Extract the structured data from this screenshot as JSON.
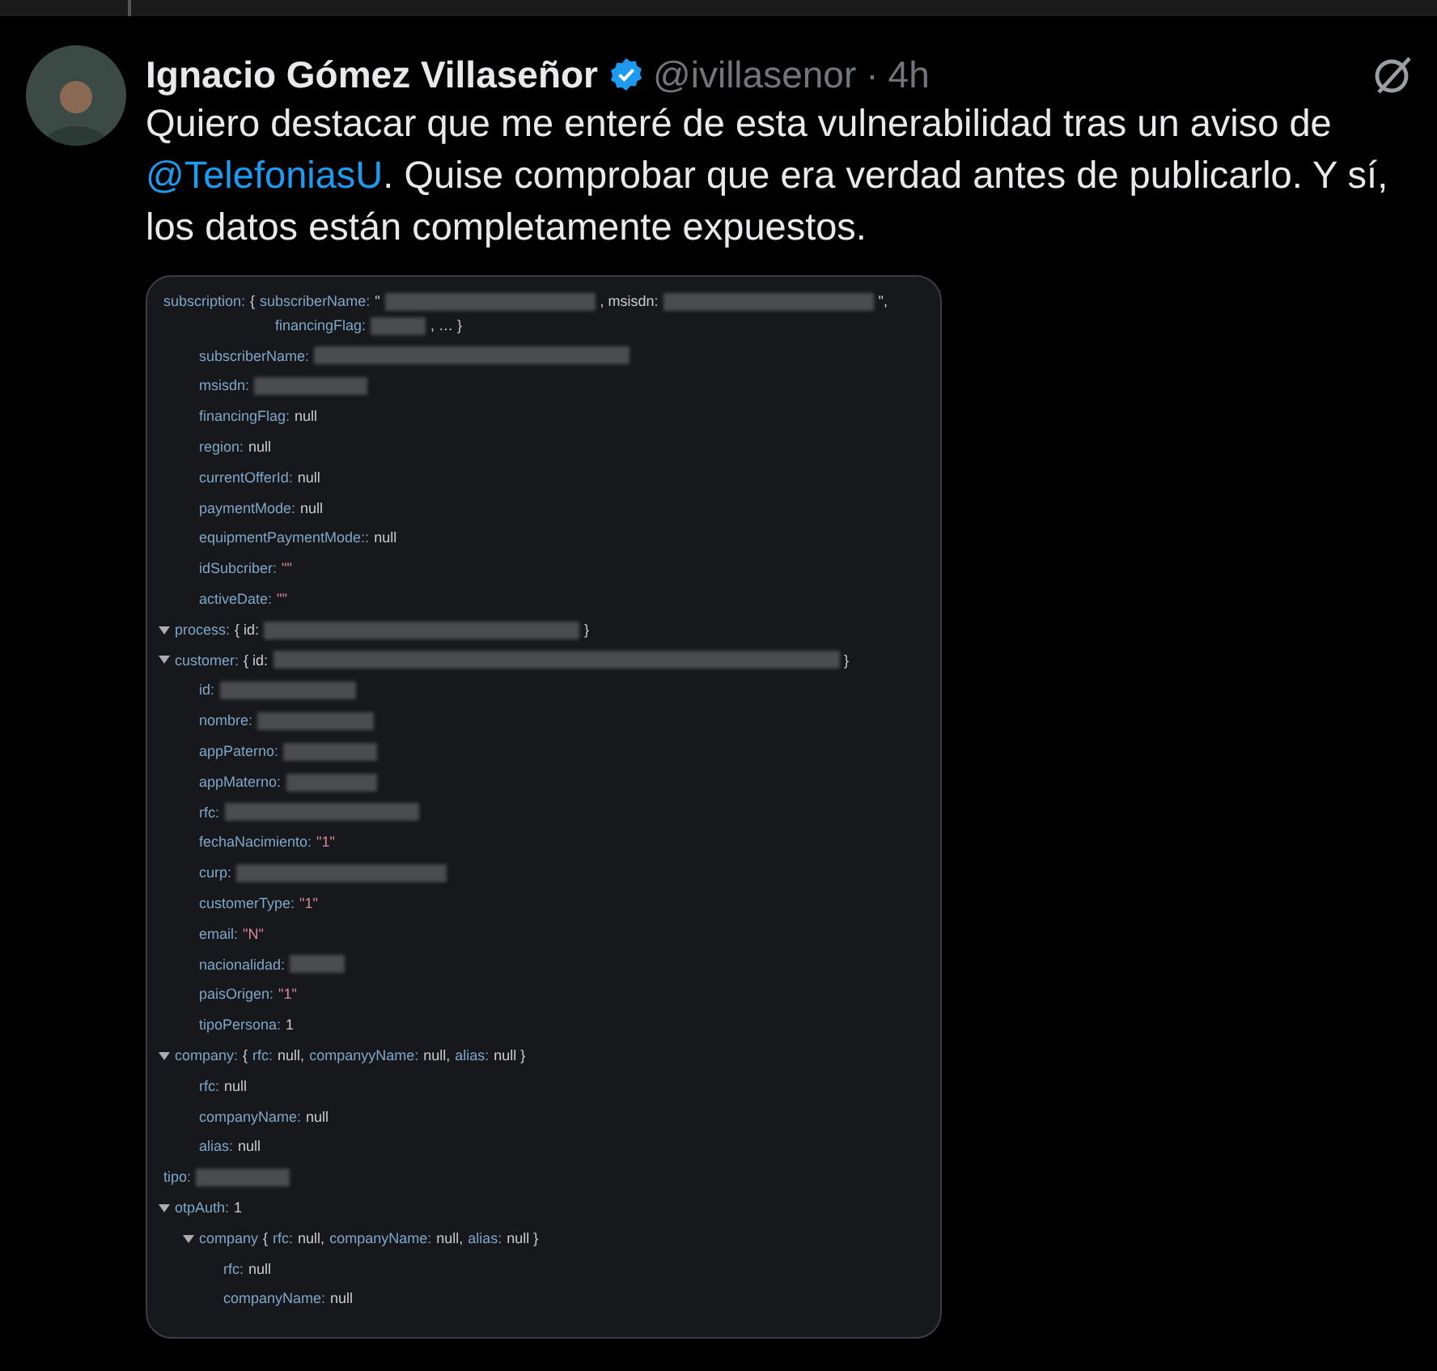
{
  "tweet": {
    "author": {
      "name": "Ignacio Gómez Villaseñor",
      "verified": true,
      "handle": "@ivillasenor",
      "separator": "·",
      "time": "4h"
    },
    "text": {
      "before": "Quiero destacar que me enteré de esta vulnerabilidad tras un aviso de",
      "mention": "@TelefoniasU",
      "after": ". Quise comprobar que era verdad antes de publicarlo. Y sí, los datos están completamente expuestos."
    },
    "media": {
      "rows": [
        {
          "toggle": false,
          "segments": [
            {
              "kind": "key",
              "text": "subscription:"
            },
            {
              "kind": "value",
              "text": "{"
            },
            {
              "kind": "key",
              "text": "subscriberName:"
            },
            {
              "kind": "value",
              "text": "\""
            },
            {
              "kind": "redacted"
            },
            {
              "kind": "value",
              "text": ", msisdn:"
            },
            {
              "kind": "redacted"
            },
            {
              "kind": "value",
              "text": "\","
            }
          ],
          "continuation": [
            {
              "kind": "key",
              "text": "financingFlag:"
            },
            {
              "kind": "redacted"
            },
            {
              "kind": "value",
              "text": ", … }"
            }
          ],
          "children": [
            {
              "toggle": false,
              "segments": [
                {
                  "kind": "key",
                  "text": "subscriberName:"
                },
                {
                  "kind": "redacted"
                }
              ]
            },
            {
              "toggle": false,
              "segments": [
                {
                  "kind": "key",
                  "text": "msisdn:"
                },
                {
                  "kind": "redacted"
                }
              ]
            },
            {
              "toggle": false,
              "segments": [
                {
                  "kind": "key",
                  "text": "financingFlag:"
                },
                {
                  "kind": "value",
                  "text": "null"
                }
              ]
            },
            {
              "toggle": false,
              "segments": [
                {
                  "kind": "key",
                  "text": "region:"
                },
                {
                  "kind": "value",
                  "text": "null"
                }
              ]
            },
            {
              "toggle": false,
              "segments": [
                {
                  "kind": "key",
                  "text": "currentOfferId:"
                },
                {
                  "kind": "value",
                  "text": "null"
                }
              ]
            },
            {
              "toggle": false,
              "segments": [
                {
                  "kind": "key",
                  "text": "paymentMode:"
                },
                {
                  "kind": "value",
                  "text": "null"
                }
              ]
            },
            {
              "toggle": false,
              "segments": [
                {
                  "kind": "key",
                  "text": "equipmentPaymentMode::"
                },
                {
                  "kind": "value",
                  "text": "null"
                }
              ]
            },
            {
              "toggle": false,
              "segments": [
                {
                  "kind": "key",
                  "text": "idSubcriber:"
                },
                {
                  "kind": "string",
                  "text": "\"\""
                }
              ]
            },
            {
              "toggle": false,
              "segments": [
                {
                  "kind": "key",
                  "text": "activeDate:"
                },
                {
                  "kind": "string",
                  "text": "\"\""
                }
              ]
            }
          ]
        },
        {
          "toggle": true,
          "segments": [
            {
              "kind": "key",
              "text": "process:"
            },
            {
              "kind": "value",
              "text": "{ id:"
            },
            {
              "kind": "redacted"
            },
            {
              "kind": "value",
              "text": "}"
            }
          ]
        },
        {
          "toggle": true,
          "segments": [
            {
              "kind": "key",
              "text": "customer:"
            },
            {
              "kind": "value",
              "text": "{ id:"
            },
            {
              "kind": "redacted"
            },
            {
              "kind": "value",
              "text": "}"
            }
          ],
          "children": [
            {
              "toggle": false,
              "segments": [
                {
                  "kind": "key",
                  "text": "id:"
                },
                {
                  "kind": "redacted"
                }
              ]
            },
            {
              "toggle": false,
              "segments": [
                {
                  "kind": "key",
                  "text": "nombre:"
                },
                {
                  "kind": "redacted"
                }
              ]
            },
            {
              "toggle": false,
              "segments": [
                {
                  "kind": "key",
                  "text": "appPaterno:"
                },
                {
                  "kind": "redacted"
                }
              ]
            },
            {
              "toggle": false,
              "segments": [
                {
                  "kind": "key",
                  "text": "appMaterno:"
                },
                {
                  "kind": "redacted"
                }
              ]
            },
            {
              "toggle": false,
              "segments": [
                {
                  "kind": "key",
                  "text": "rfc:"
                },
                {
                  "kind": "redacted"
                }
              ]
            },
            {
              "toggle": false,
              "segments": [
                {
                  "kind": "key",
                  "text": "fechaNacimiento:"
                },
                {
                  "kind": "string",
                  "text": "\"1\""
                }
              ]
            },
            {
              "toggle": false,
              "segments": [
                {
                  "kind": "key",
                  "text": "curp:"
                },
                {
                  "kind": "redacted"
                }
              ]
            },
            {
              "toggle": false,
              "segments": [
                {
                  "kind": "key",
                  "text": "customerType:"
                },
                {
                  "kind": "string",
                  "text": "\"1\""
                }
              ]
            },
            {
              "toggle": false,
              "segments": [
                {
                  "kind": "key",
                  "text": "email:"
                },
                {
                  "kind": "string",
                  "text": "\"N\""
                }
              ]
            },
            {
              "toggle": false,
              "segments": [
                {
                  "kind": "key",
                  "text": "nacionalidad:"
                },
                {
                  "kind": "redacted"
                }
              ]
            },
            {
              "toggle": false,
              "segments": [
                {
                  "kind": "key",
                  "text": "paisOrigen:"
                },
                {
                  "kind": "string",
                  "text": "\"1\""
                }
              ]
            },
            {
              "toggle": false,
              "segments": [
                {
                  "kind": "key",
                  "text": "tipoPersona:"
                },
                {
                  "kind": "value",
                  "text": "1"
                }
              ]
            }
          ]
        },
        {
          "toggle": true,
          "segments": [
            {
              "kind": "key",
              "text": "company:"
            },
            {
              "kind": "value",
              "text": "{"
            },
            {
              "kind": "key",
              "text": "rfc:"
            },
            {
              "kind": "value",
              "text": "null,"
            },
            {
              "kind": "key",
              "text": "companyyName:"
            },
            {
              "kind": "value",
              "text": "null,"
            },
            {
              "kind": "key",
              "text": "alias:"
            },
            {
              "kind": "value",
              "text": "null }"
            }
          ],
          "children": [
            {
              "toggle": false,
              "segments": [
                {
                  "kind": "key",
                  "text": "rfc:"
                },
                {
                  "kind": "value",
                  "text": "null"
                }
              ]
            },
            {
              "toggle": false,
              "segments": [
                {
                  "kind": "key",
                  "text": "companyName:"
                },
                {
                  "kind": "value",
                  "text": "null"
                }
              ]
            },
            {
              "toggle": false,
              "segments": [
                {
                  "kind": "key",
                  "text": "alias:"
                },
                {
                  "kind": "value",
                  "text": "null"
                }
              ]
            }
          ]
        },
        {
          "toggle": false,
          "segments": [
            {
              "kind": "key",
              "text": "tipo:"
            },
            {
              "kind": "redacted"
            }
          ]
        },
        {
          "toggle": true,
          "segments": [
            {
              "kind": "key",
              "text": "otpAuth:"
            },
            {
              "kind": "value",
              "text": "1"
            }
          ],
          "children": [
            {
              "toggle": true,
              "segments": [
                {
                  "kind": "key",
                  "text": "company"
                },
                {
                  "kind": "value",
                  "text": "{"
                },
                {
                  "kind": "key",
                  "text": "rfc:"
                },
                {
                  "kind": "value",
                  "text": "null,"
                },
                {
                  "kind": "key",
                  "text": "companyName:"
                },
                {
                  "kind": "value",
                  "text": "null,"
                },
                {
                  "kind": "key",
                  "text": "alias:"
                },
                {
                  "kind": "value",
                  "text": "null }"
                }
              ],
              "children": [
                {
                  "toggle": false,
                  "segments": [
                    {
                      "kind": "key",
                      "text": "rfc:"
                    },
                    {
                      "kind": "value",
                      "text": "null"
                    }
                  ]
                },
                {
                  "toggle": false,
                  "segments": [
                    {
                      "kind": "key",
                      "text": "companyName:"
                    },
                    {
                      "kind": "value",
                      "text": "null"
                    }
                  ]
                }
              ]
            }
          ]
        }
      ]
    }
  }
}
